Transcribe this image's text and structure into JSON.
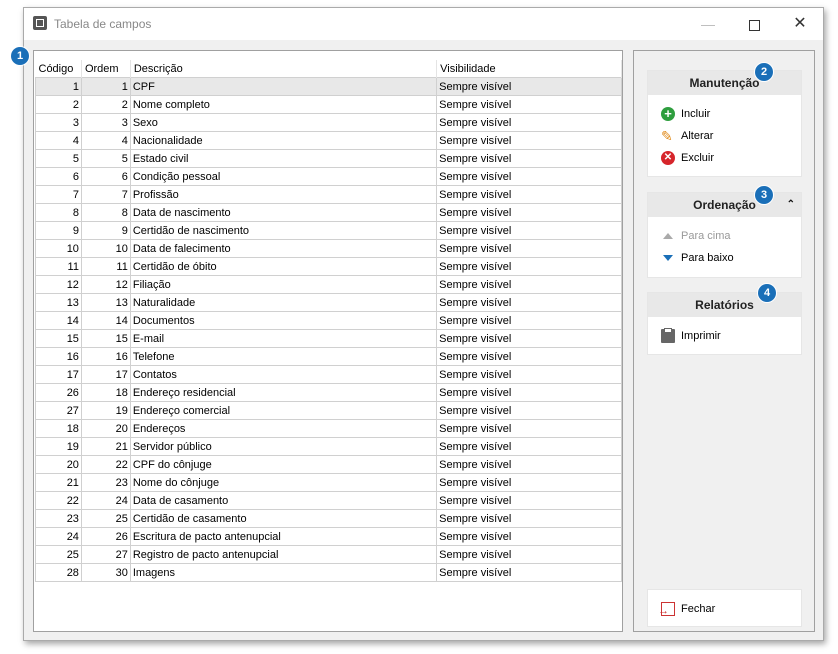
{
  "window": {
    "title": "Tabela de campos"
  },
  "badges": [
    "1",
    "2",
    "3",
    "4"
  ],
  "table": {
    "headers": [
      "Código",
      "Ordem",
      "Descrição",
      "Visibilidade"
    ],
    "rows": [
      [
        "1",
        "1",
        "CPF",
        "Sempre visível"
      ],
      [
        "2",
        "2",
        "Nome completo",
        "Sempre visível"
      ],
      [
        "3",
        "3",
        "Sexo",
        "Sempre visível"
      ],
      [
        "4",
        "4",
        "Nacionalidade",
        "Sempre visível"
      ],
      [
        "5",
        "5",
        "Estado civil",
        "Sempre visível"
      ],
      [
        "6",
        "6",
        "Condição pessoal",
        "Sempre visível"
      ],
      [
        "7",
        "7",
        "Profissão",
        "Sempre visível"
      ],
      [
        "8",
        "8",
        "Data de nascimento",
        "Sempre visível"
      ],
      [
        "9",
        "9",
        "Certidão de nascimento",
        "Sempre visível"
      ],
      [
        "10",
        "10",
        "Data de falecimento",
        "Sempre visível"
      ],
      [
        "11",
        "11",
        "Certidão de óbito",
        "Sempre visível"
      ],
      [
        "12",
        "12",
        "Filiação",
        "Sempre visível"
      ],
      [
        "13",
        "13",
        "Naturalidade",
        "Sempre visível"
      ],
      [
        "14",
        "14",
        "Documentos",
        "Sempre visível"
      ],
      [
        "15",
        "15",
        "E-mail",
        "Sempre visível"
      ],
      [
        "16",
        "16",
        "Telefone",
        "Sempre visível"
      ],
      [
        "17",
        "17",
        "Contatos",
        "Sempre visível"
      ],
      [
        "26",
        "18",
        "Endereço residencial",
        "Sempre visível"
      ],
      [
        "27",
        "19",
        "Endereço comercial",
        "Sempre visível"
      ],
      [
        "18",
        "20",
        "Endereços",
        "Sempre visível"
      ],
      [
        "19",
        "21",
        "Servidor público",
        "Sempre visível"
      ],
      [
        "20",
        "22",
        "CPF do cônjuge",
        "Sempre visível"
      ],
      [
        "21",
        "23",
        "Nome do cônjuge",
        "Sempre visível"
      ],
      [
        "22",
        "24",
        "Data de casamento",
        "Sempre visível"
      ],
      [
        "23",
        "25",
        "Certidão de casamento",
        "Sempre visível"
      ],
      [
        "24",
        "26",
        "Escritura de pacto antenupcial",
        "Sempre visível"
      ],
      [
        "25",
        "27",
        "Registro de pacto antenupcial",
        "Sempre visível"
      ],
      [
        "28",
        "30",
        "Imagens",
        "Sempre visível"
      ]
    ]
  },
  "sidebar": {
    "manutencao": {
      "title": "Manutenção",
      "incluir": "Incluir",
      "alterar": "Alterar",
      "excluir": "Excluir"
    },
    "ordenacao": {
      "title": "Ordenação",
      "para_cima": "Para cima",
      "para_baixo": "Para baixo"
    },
    "relatorios": {
      "title": "Relatórios",
      "imprimir": "Imprimir"
    },
    "fechar": "Fechar"
  },
  "colors": {
    "badge": "#1a6fb8",
    "add": "#2e9e3e",
    "delete": "#d6252b"
  }
}
